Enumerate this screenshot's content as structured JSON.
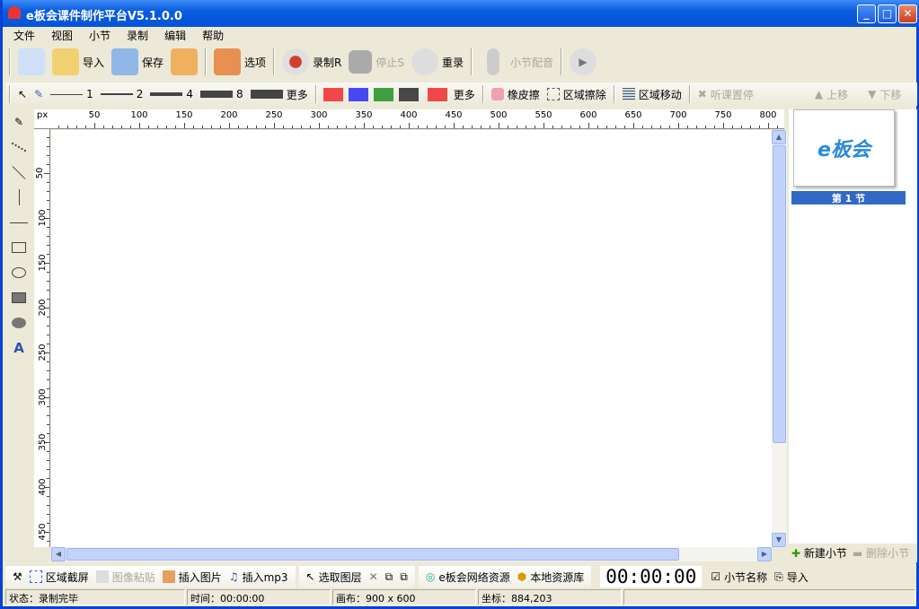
{
  "window": {
    "title": "e板会课件制作平台V5.1.0.0",
    "minimize": "_",
    "maximize": "□",
    "close": "✕"
  },
  "menu": [
    "文件",
    "视图",
    "小节",
    "录制",
    "编辑",
    "帮助"
  ],
  "toolbar": {
    "import": "导入",
    "save": "保存",
    "options": "选项",
    "record": "录制R",
    "stop": "停止S",
    "rerecord": "重录",
    "dub": "小节配音"
  },
  "drawbar": {
    "widths": [
      "1",
      "2",
      "4",
      "8"
    ],
    "more_width": "更多",
    "colors": [
      "#f04848",
      "#4848f0",
      "#40a040",
      "#484848",
      "#f04848"
    ],
    "more_color": "更多",
    "eraser": "橡皮擦",
    "area_erase": "区域擦除",
    "area_move": "区域移动",
    "pause": "听课置停",
    "up": "上移",
    "down": "下移"
  },
  "ruler": {
    "unit": "px",
    "h_ticks": [
      50,
      100,
      150,
      200,
      250,
      300,
      350,
      400,
      450,
      500,
      550,
      600,
      650,
      700,
      750,
      800
    ],
    "v_ticks": [
      50,
      100,
      150,
      200,
      250,
      300,
      350,
      400,
      450
    ]
  },
  "sections": {
    "thumb_logo": "e板会",
    "current": "第 1 节",
    "new": "新建小节",
    "delete": "删除小节"
  },
  "bottombar": {
    "screenshot": "区域截屏",
    "paste": "图像粘贴",
    "insert_image": "插入图片",
    "insert_mp3": "插入mp3",
    "select_layer": "选取图层",
    "net_res": "e板会网络资源",
    "local_res": "本地资源库",
    "timer": "00:00:00",
    "section_name": "小节名称",
    "import": "导入"
  },
  "status": {
    "state": "状态：录制完毕",
    "time": "时间：00:00:00",
    "canvas": "画布：900 x 600",
    "coords": "坐标：884,203"
  }
}
